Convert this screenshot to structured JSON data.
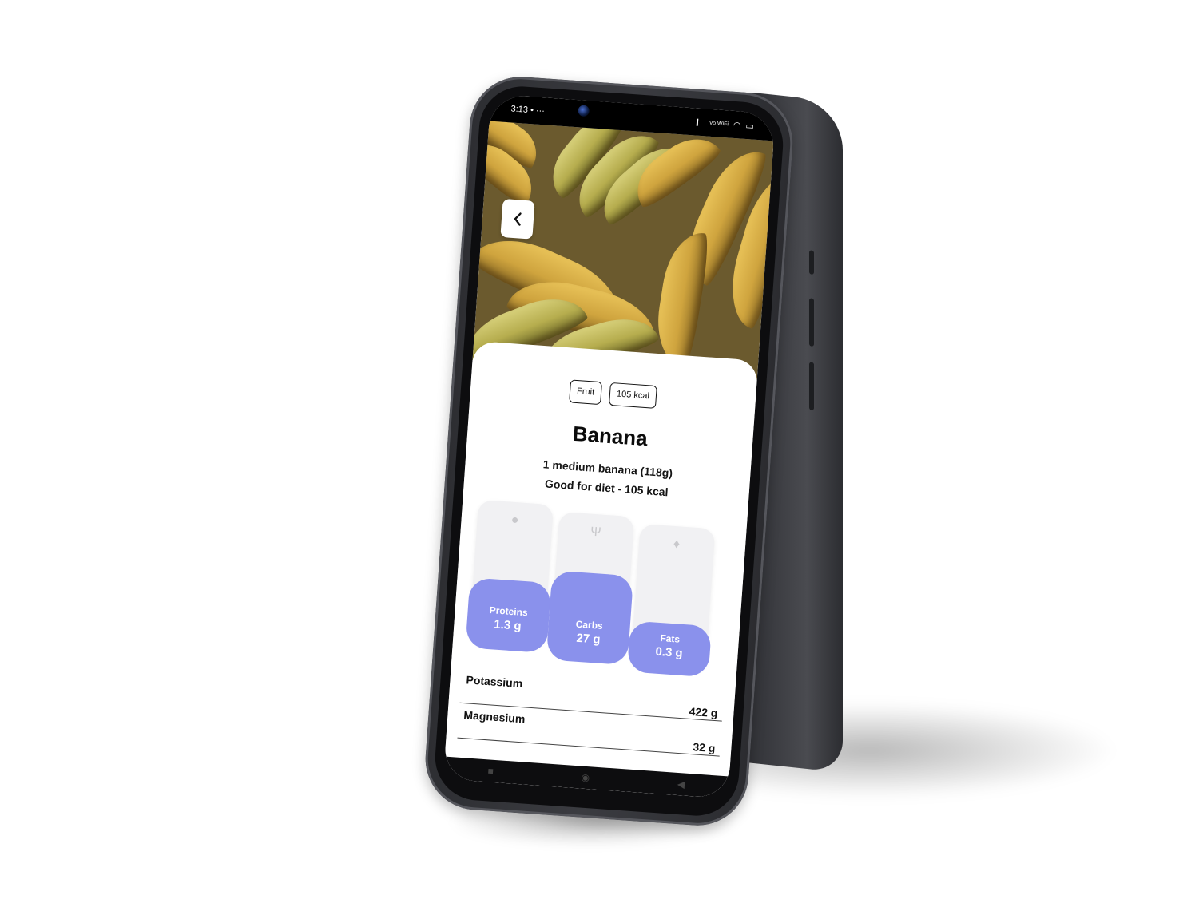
{
  "status_bar": {
    "time": "3:13",
    "extra": "• ···",
    "network": "Vo WiFi"
  },
  "header": {
    "back_icon": "chevron-left-icon"
  },
  "tags": [
    "Fruit",
    "105 kcal"
  ],
  "food": {
    "name": "Banana",
    "serving": "1 medium banana (118g)",
    "note": "Good for diet - 105 kcal"
  },
  "macros": [
    {
      "label": "Proteins",
      "value": "1.3 g",
      "icon": "apple-icon"
    },
    {
      "label": "Carbs",
      "value": "27 g",
      "icon": "cutlery-icon"
    },
    {
      "label": "Fats",
      "value": "0.3 g",
      "icon": "drop-icon"
    }
  ],
  "nutrients": [
    {
      "name": "Potassium",
      "value": "422 g"
    },
    {
      "name": "Magnesium",
      "value": "32 g"
    }
  ],
  "colors": {
    "accent": "#8a91ec",
    "phone": "#2d2e32",
    "card": "#ffffff"
  }
}
